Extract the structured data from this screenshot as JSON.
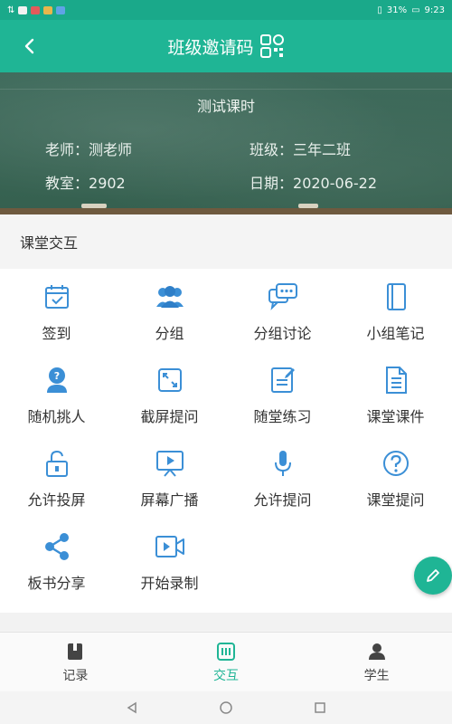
{
  "status_bar": {
    "battery": "31%",
    "time": "9:23"
  },
  "header": {
    "title": "班级邀请码",
    "back_icon": "chevron-left-icon",
    "qr_icon": "qr-code-icon"
  },
  "class_info": {
    "lesson_title": "测试课时",
    "teacher_label": "老师：",
    "teacher": "测老师",
    "class_label": "班级：",
    "class_name": "三年二班",
    "room_label": "教室：",
    "room": "2902",
    "date_label": "日期：",
    "date": "2020-06-22"
  },
  "section": {
    "title": "课堂交互"
  },
  "features": [
    {
      "label": "签到",
      "icon": "calendar-check-icon"
    },
    {
      "label": "分组",
      "icon": "group-icon"
    },
    {
      "label": "分组讨论",
      "icon": "chat-bubbles-icon"
    },
    {
      "label": "小组笔记",
      "icon": "notebook-icon"
    },
    {
      "label": "随机挑人",
      "icon": "person-badge-icon"
    },
    {
      "label": "截屏提问",
      "icon": "screenshot-icon"
    },
    {
      "label": "随堂练习",
      "icon": "edit-document-icon"
    },
    {
      "label": "课堂课件",
      "icon": "document-icon"
    },
    {
      "label": "允许投屏",
      "icon": "unlock-icon"
    },
    {
      "label": "屏幕广播",
      "icon": "broadcast-screen-icon"
    },
    {
      "label": "允许提问",
      "icon": "microphone-icon"
    },
    {
      "label": "课堂提问",
      "icon": "question-circle-icon"
    },
    {
      "label": "板书分享",
      "icon": "share-icon"
    },
    {
      "label": "开始录制",
      "icon": "video-record-icon"
    }
  ],
  "tabs": [
    {
      "label": "记录",
      "icon": "book-icon",
      "active": false
    },
    {
      "label": "交互",
      "icon": "interaction-icon",
      "active": true
    },
    {
      "label": "学生",
      "icon": "student-icon",
      "active": false
    }
  ],
  "colors": {
    "brand": "#1fb595",
    "icon_blue": "#3b8fd6",
    "chalkboard": "#3f6b5c"
  }
}
